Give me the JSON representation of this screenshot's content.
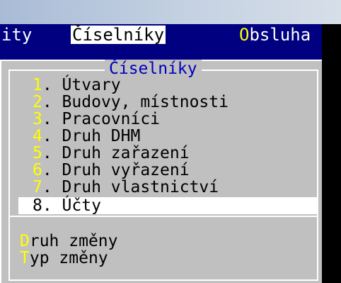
{
  "menubar": {
    "items": [
      {
        "label": "ity",
        "hot": "",
        "rest": "ity",
        "selected": false
      },
      {
        "label": "Číselníky",
        "hot": "",
        "rest": "Číselníky",
        "selected": true
      },
      {
        "label": "Obsluha",
        "hot": "O",
        "rest": "bsluha",
        "selected": false
      }
    ]
  },
  "dropdown": {
    "title": "Číselníky",
    "items": [
      {
        "num": "1",
        "text": ". Útvary"
      },
      {
        "num": "2",
        "text": ". Budovy, místnosti"
      },
      {
        "num": "3",
        "text": ". Pracovníci"
      },
      {
        "num": "4",
        "text": ". Druh DHM"
      },
      {
        "num": "5",
        "text": ". Druh zařazení"
      },
      {
        "num": "6",
        "text": ". Druh vyřazení"
      },
      {
        "num": "7",
        "text": ". Druh vlastnictví"
      },
      {
        "num": "8",
        "text": ". Účty"
      }
    ],
    "selected_index": 7,
    "bottom_items": [
      {
        "hot": "D",
        "rest": "ruh změny"
      },
      {
        "hot": "T",
        "rest": "yp změny"
      }
    ]
  },
  "colors": {
    "menubar_bg": "#000080",
    "dropdown_bg": "#c0c0c0",
    "hotkey": "#ffff00",
    "title": "#0000c0"
  }
}
